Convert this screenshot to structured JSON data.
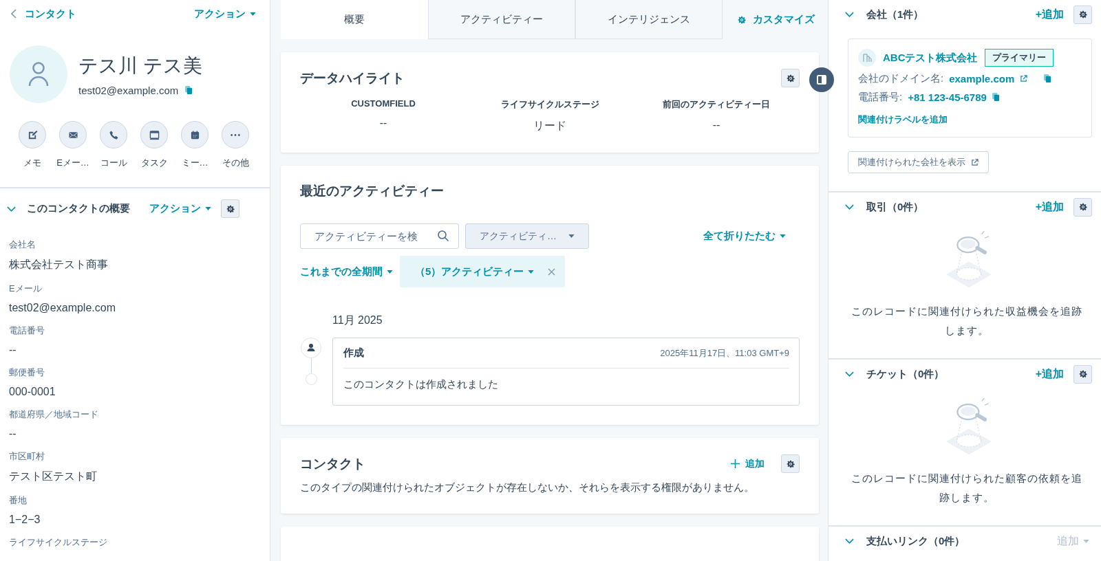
{
  "left": {
    "back_link": "コンタクト",
    "actions_menu": "アクション",
    "contact": {
      "name": "テス川 テス美",
      "email": "test02@example.com"
    },
    "quick_actions": [
      {
        "label": "メモ",
        "kind": "note"
      },
      {
        "label": "Eメー…",
        "kind": "email"
      },
      {
        "label": "コール",
        "kind": "call"
      },
      {
        "label": "タスク",
        "kind": "task"
      },
      {
        "label": "ミー…",
        "kind": "meeting"
      },
      {
        "label": "その他",
        "kind": "more"
      }
    ],
    "about": {
      "title": "このコンタクトの概要",
      "actions_menu": "アクション",
      "fields": [
        {
          "label": "会社名",
          "value": "株式会社テスト商事"
        },
        {
          "label": "Eメール",
          "value": "test02@example.com"
        },
        {
          "label": "電話番号",
          "value": "--"
        },
        {
          "label": "郵便番号",
          "value": "000-0001"
        },
        {
          "label": "都道府県／地域コード",
          "value": "--"
        },
        {
          "label": "市区町村",
          "value": "テスト区テスト町"
        },
        {
          "label": "番地",
          "value": "1−2−3"
        },
        {
          "label": "ライフサイクルステージ"
        }
      ]
    }
  },
  "tabs": [
    {
      "label": "概要",
      "selected": true
    },
    {
      "label": "アクティビティー",
      "selected": false
    },
    {
      "label": "インテリジェンス",
      "selected": false
    }
  ],
  "customize_button": "カスタマイズ",
  "data_highlights": {
    "title": "データハイライト",
    "items": [
      {
        "label": "CUSTOMFIELD",
        "value": "--"
      },
      {
        "label": "ライフサイクルステージ",
        "value": "リード"
      },
      {
        "label": "前回のアクティビティー日",
        "value": "--"
      }
    ]
  },
  "recent_activities": {
    "title": "最近のアクティビティー",
    "search": {
      "placeholder": "アクティビティーを検"
    },
    "type_filter": "アクティビティ…",
    "collapse_all": "全て折りたたむ",
    "period_filter": "これまでの全期間",
    "activity_filter": "（5）アクティビティー",
    "month": "11月 2025",
    "items": [
      {
        "title": "作成",
        "timestamp": "2025年11月17日、11:03 GMT+9",
        "body": "このコンタクトは作成されました"
      }
    ]
  },
  "contacts_card": {
    "title": "コンタクト",
    "add_button": "追加",
    "message": "このタイプの関連付けられたオブジェクトが存在しないか、それらを表示する権限がありません。"
  },
  "right_sections": [
    {
      "kind": "company",
      "title": "会社（1件）",
      "add_button": "+追加",
      "company": {
        "name": "ABCテスト株式会社",
        "badge": "プライマリー",
        "domain_label": "会社のドメイン名:",
        "domain": "example.com",
        "phone_label": "電話番号:",
        "phone": "+81 123-45-6789",
        "label_link": "関連付けラベルを追加"
      },
      "view_button": "関連付けられた会社を表示"
    },
    {
      "kind": "empty",
      "title": "取引（0件）",
      "add_button": "+追加",
      "message": "このレコードに関連付けられた収益機会を追跡します。"
    },
    {
      "kind": "empty",
      "title": "チケット（0件）",
      "add_button": "+追加",
      "message": "このレコードに関連付けられた顧客の依頼を追跡します。"
    },
    {
      "kind": "menu",
      "title": "支払いリンク（0件）",
      "add_menu": "追加",
      "add_disabled": true
    }
  ]
}
